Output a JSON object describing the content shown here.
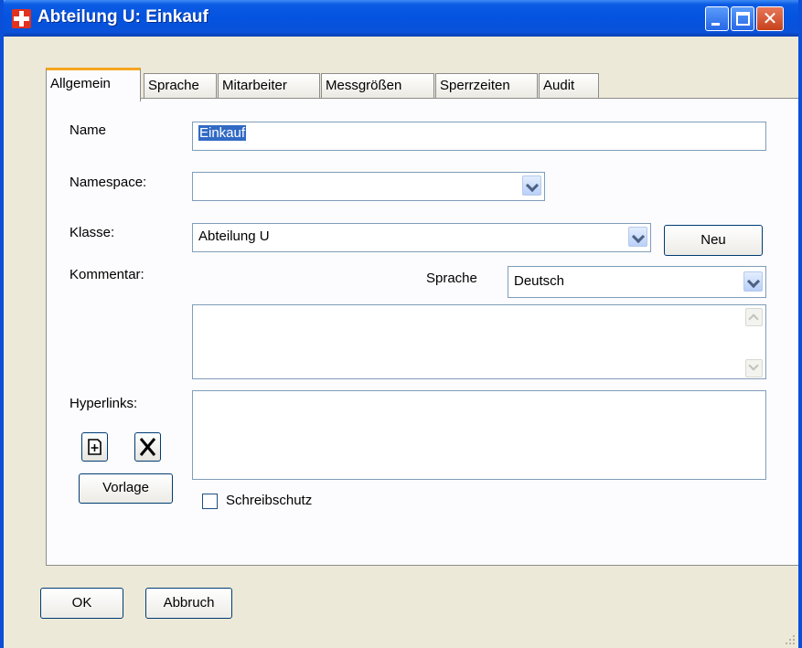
{
  "window": {
    "title": "Abteilung U: Einkauf"
  },
  "tabs": [
    {
      "label": "Allgemein",
      "active": true
    },
    {
      "label": "Sprache",
      "active": false
    },
    {
      "label": "Mitarbeiter",
      "active": false
    },
    {
      "label": "Messgrößen",
      "active": false
    },
    {
      "label": "Sperrzeiten",
      "active": false
    },
    {
      "label": "Audit",
      "active": false
    }
  ],
  "form": {
    "name_label": "Name",
    "name_value": "Einkauf",
    "namespace_label": "Namespace:",
    "namespace_value": "",
    "klasse_label": "Klasse:",
    "klasse_value": "Abteilung U",
    "neu_label": "Neu",
    "kommentar_label": "Kommentar:",
    "sprache_label": "Sprache",
    "sprache_value": "Deutsch",
    "kommentar_value": "",
    "hyperlinks_label": "Hyperlinks:",
    "vorlage_label": "Vorlage",
    "schreibschutz_label": "Schreibschutz",
    "schreibschutz_checked": false
  },
  "footer": {
    "ok_label": "OK",
    "abbruch_label": "Abbruch"
  },
  "icons": {
    "app": "red-cross-icon",
    "add_link": "add-document-icon",
    "delete_link": "delete-x-icon"
  },
  "colors": {
    "titlebar": "#0453e0",
    "active_tab_accent": "#f5a621",
    "selection": "#316ac5"
  }
}
